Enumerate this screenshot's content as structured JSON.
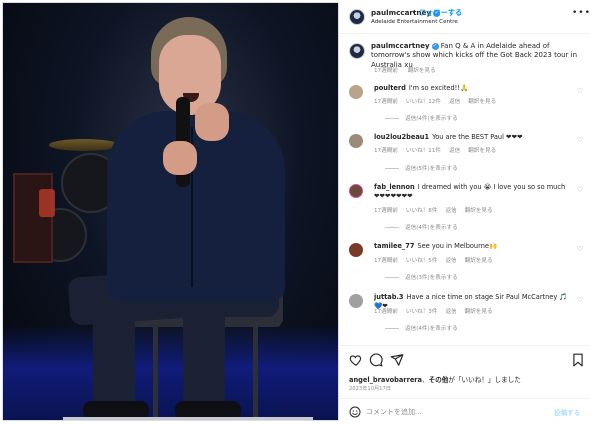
{
  "photo": {
    "alt_icon": "photo-paul-mccartney"
  },
  "header": {
    "username": "paulmccartney",
    "separator": "•",
    "follow_label": "フォローする",
    "location": "Adelaide Entertainment Centre",
    "more_icon": "more-horizontal-icon"
  },
  "caption": {
    "username": "paulmccartney",
    "text": "Fan Q & A in Adelaide ahead of tomorrow's show which kicks off the Got Back 2023 tour in Australia",
    "tail": "xu",
    "time": "17週間前",
    "translate": "翻訳を見る"
  },
  "comments": [
    {
      "username": "poulterd",
      "text": "I'm so excited!!🙏",
      "time": "17週間前",
      "likes": "いいね！12件",
      "reply": "返信",
      "translate": "翻訳を見る",
      "replies": "返信(4件)を表示する",
      "avatar_color": "#b8a48a"
    },
    {
      "username": "lou2lou2beau1",
      "text": "You are the BEST Paul ❤❤❤",
      "time": "17週間前",
      "likes": "いいね！11件",
      "reply": "返信",
      "translate": "翻訳を見る",
      "replies": "返信(5件)を表示する",
      "avatar_color": "#9a8a7a"
    },
    {
      "username": "fab_lennon",
      "text": "I dreamed with you 😭 I love you so so much❤❤❤❤❤❤❤",
      "time": "17週間前",
      "likes": "いいね！8件",
      "reply": "返信",
      "translate": "翻訳を見る",
      "replies": "返信(4件)を表示する",
      "avatar_color": "#6b4a3a"
    },
    {
      "username": "tamilee_77",
      "text": "See you in Melbourne🙌",
      "time": "17週間前",
      "likes": "いいね！5件",
      "reply": "返信",
      "translate": "翻訳を見る",
      "replies": "返信(3件)を表示する",
      "avatar_color": "#7a3a2a"
    },
    {
      "username": "juttab.3",
      "text": "Have a nice time on stage Sir Paul McCartney 🎵💙❤",
      "time": "17週間前",
      "likes": "いいね！3件",
      "reply": "返信",
      "translate": "翻訳を見る",
      "replies": "返信(4件)を表示する",
      "avatar_color": "#a0a0a0"
    }
  ],
  "actions": {
    "like_icon": "heart-icon",
    "comment_icon": "comment-icon",
    "share_icon": "send-icon",
    "save_icon": "bookmark-icon"
  },
  "likes_line": {
    "username": "angel_bravobarrera",
    "middle": "、",
    "others": "その他",
    "suffix": "が「いいね！」しました"
  },
  "date": "2023年10月17日",
  "composer": {
    "placeholder": "コメントを追加...",
    "post_label": "投稿する",
    "emoji_icon": "emoji-icon"
  },
  "colors": {
    "link_blue": "#0095f6",
    "muted": "#8e8e8e",
    "stage_blue": "#101c7a"
  }
}
